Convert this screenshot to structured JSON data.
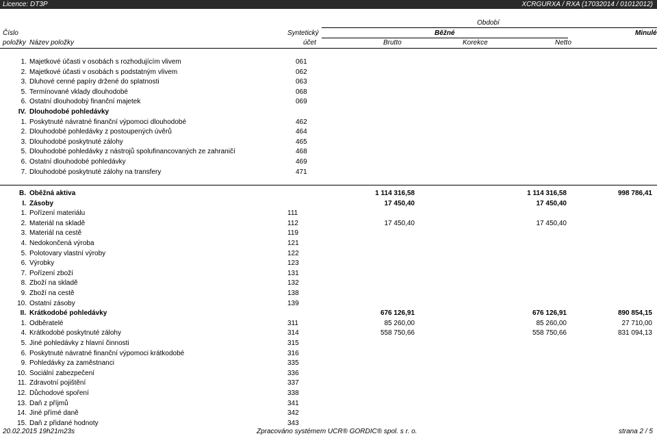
{
  "topbar": {
    "licence": "Licence: DT3P",
    "report_id": "XCRGURXA / RXA (17032014 / 01012012)"
  },
  "header": {
    "obdobi": "Období",
    "cislo": "Číslo",
    "polozky": "položky",
    "nazev": "Název položky",
    "synteticky": "Syntetický",
    "ucet": "účet",
    "bezne": "Běžné",
    "minule": "Minulé",
    "brutto": "Brutto",
    "korekce": "Korekce",
    "netto": "Netto"
  },
  "rows_top": [
    {
      "num": "1.",
      "name": "Majetkové účasti v osobách s rozhodujícím vlivem",
      "code": "061"
    },
    {
      "num": "2.",
      "name": "Majetkové účasti v osobách s podstatným vlivem",
      "code": "062"
    },
    {
      "num": "3.",
      "name": "Dluhové cenné papíry držené do splatnosti",
      "code": "063"
    },
    {
      "num": "5.",
      "name": "Termínované vklady dlouhodobé",
      "code": "068"
    },
    {
      "num": "6.",
      "name": "Ostatní dlouhodobý finanční majetek",
      "code": "069"
    },
    {
      "rom": "IV.",
      "name": "Dlouhodobé pohledávky",
      "code": "",
      "bold": true
    },
    {
      "num": "1.",
      "name": "Poskytnuté návratné finanční výpomoci dlouhodobé",
      "code": "462"
    },
    {
      "num": "2.",
      "name": "Dlouhodobé pohledávky z postoupených úvěrů",
      "code": "464"
    },
    {
      "num": "3.",
      "name": "Dlouhodobé poskytnuté zálohy",
      "code": "465"
    },
    {
      "num": "5.",
      "name": "Dlouhodobé pohledávky z nástrojů spolufinancovaných ze zahraničí",
      "code": "468"
    },
    {
      "num": "6.",
      "name": "Ostatní dlouhodobé pohledávky",
      "code": "469"
    },
    {
      "num": "7.",
      "name": "Dlouhodobé poskytnuté zálohy na transfery",
      "code": "471"
    }
  ],
  "rows_b": [
    {
      "rom": "B.",
      "name": "Oběžná aktiva",
      "code": "",
      "brutto": "1 114 316,58",
      "netto": "1 114 316,58",
      "minule": "998 786,41",
      "bold": true
    },
    {
      "rom": "I.",
      "name": "Zásoby",
      "code": "",
      "brutto": "17 450,40",
      "netto": "17 450,40",
      "minule": "",
      "bold": true
    },
    {
      "num": "1.",
      "name": "Pořízení materiálu",
      "code": "111",
      "brutto": "",
      "netto": "",
      "minule": ""
    },
    {
      "num": "2.",
      "name": "Materiál na skladě",
      "code": "112",
      "brutto": "17 450,40",
      "netto": "17 450,40",
      "minule": ""
    },
    {
      "num": "3.",
      "name": "Materiál na cestě",
      "code": "119",
      "brutto": "",
      "netto": "",
      "minule": ""
    },
    {
      "num": "4.",
      "name": "Nedokončená výroba",
      "code": "121",
      "brutto": "",
      "netto": "",
      "minule": ""
    },
    {
      "num": "5.",
      "name": "Polotovary vlastní výroby",
      "code": "122",
      "brutto": "",
      "netto": "",
      "minule": ""
    },
    {
      "num": "6.",
      "name": "Výrobky",
      "code": "123",
      "brutto": "",
      "netto": "",
      "minule": ""
    },
    {
      "num": "7.",
      "name": "Pořízení zboží",
      "code": "131",
      "brutto": "",
      "netto": "",
      "minule": ""
    },
    {
      "num": "8.",
      "name": "Zboží na skladě",
      "code": "132",
      "brutto": "",
      "netto": "",
      "minule": ""
    },
    {
      "num": "9.",
      "name": "Zboží na cestě",
      "code": "138",
      "brutto": "",
      "netto": "",
      "minule": ""
    },
    {
      "num": "10.",
      "name": "Ostatní zásoby",
      "code": "139",
      "brutto": "",
      "netto": "",
      "minule": ""
    },
    {
      "rom": "II.",
      "name": "Krátkodobé pohledávky",
      "code": "",
      "brutto": "676 126,91",
      "netto": "676 126,91",
      "minule": "890 854,15",
      "bold": true
    },
    {
      "num": "1.",
      "name": "Odběratelé",
      "code": "311",
      "brutto": "85 260,00",
      "netto": "85 260,00",
      "minule": "27 710,00"
    },
    {
      "num": "4.",
      "name": "Krátkodobé poskytnuté zálohy",
      "code": "314",
      "brutto": "558 750,66",
      "netto": "558 750,66",
      "minule": "831 094,13"
    },
    {
      "num": "5.",
      "name": "Jiné pohledávky z hlavní činnosti",
      "code": "315",
      "brutto": "",
      "netto": "",
      "minule": ""
    },
    {
      "num": "6.",
      "name": "Poskytnuté návratné finanční výpomoci krátkodobé",
      "code": "316",
      "brutto": "",
      "netto": "",
      "minule": ""
    },
    {
      "num": "9.",
      "name": "Pohledávky za zaměstnanci",
      "code": "335",
      "brutto": "",
      "netto": "",
      "minule": ""
    },
    {
      "num": "10.",
      "name": "Sociální zabezpečení",
      "code": "336",
      "brutto": "",
      "netto": "",
      "minule": ""
    },
    {
      "num": "11.",
      "name": "Zdravotní pojištění",
      "code": "337",
      "brutto": "",
      "netto": "",
      "minule": ""
    },
    {
      "num": "12.",
      "name": "Důchodové spoření",
      "code": "338",
      "brutto": "",
      "netto": "",
      "minule": ""
    },
    {
      "num": "13.",
      "name": "Daň z příjmů",
      "code": "341",
      "brutto": "",
      "netto": "",
      "minule": ""
    },
    {
      "num": "14.",
      "name": "Jiné přímé daně",
      "code": "342",
      "brutto": "",
      "netto": "",
      "minule": ""
    },
    {
      "num": "15.",
      "name": "Daň z přidané hodnoty",
      "code": "343",
      "brutto": "",
      "netto": "",
      "minule": ""
    }
  ],
  "footer": {
    "datetime": "20.02.2015 19h21m23s",
    "system": "Zpracováno systémem UCR® GORDIC® spol. s  r. o.",
    "page": "strana 2 / 5"
  }
}
